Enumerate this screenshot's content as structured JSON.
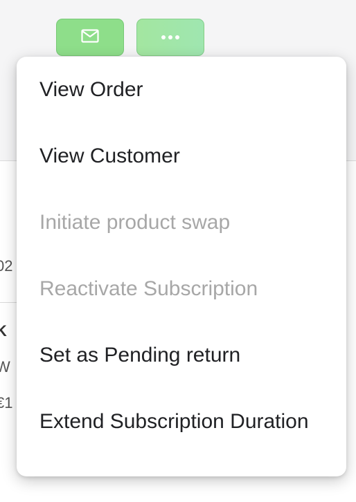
{
  "toolbar": {
    "email_icon": "envelope-icon",
    "more_icon": "more-horizontal-icon",
    "accent_color": "#8ede8a"
  },
  "background": {
    "line1": "02",
    "line2": "K",
    "line3": "W",
    "line4": "€1"
  },
  "menu": {
    "items": [
      {
        "label": "View Order",
        "enabled": true
      },
      {
        "label": "View Customer",
        "enabled": true
      },
      {
        "label": "Initiate product swap",
        "enabled": false
      },
      {
        "label": "Reactivate Subscription",
        "enabled": false
      },
      {
        "label": "Set as Pending return",
        "enabled": true
      },
      {
        "label": "Extend Subscription Duration",
        "enabled": true
      }
    ]
  }
}
